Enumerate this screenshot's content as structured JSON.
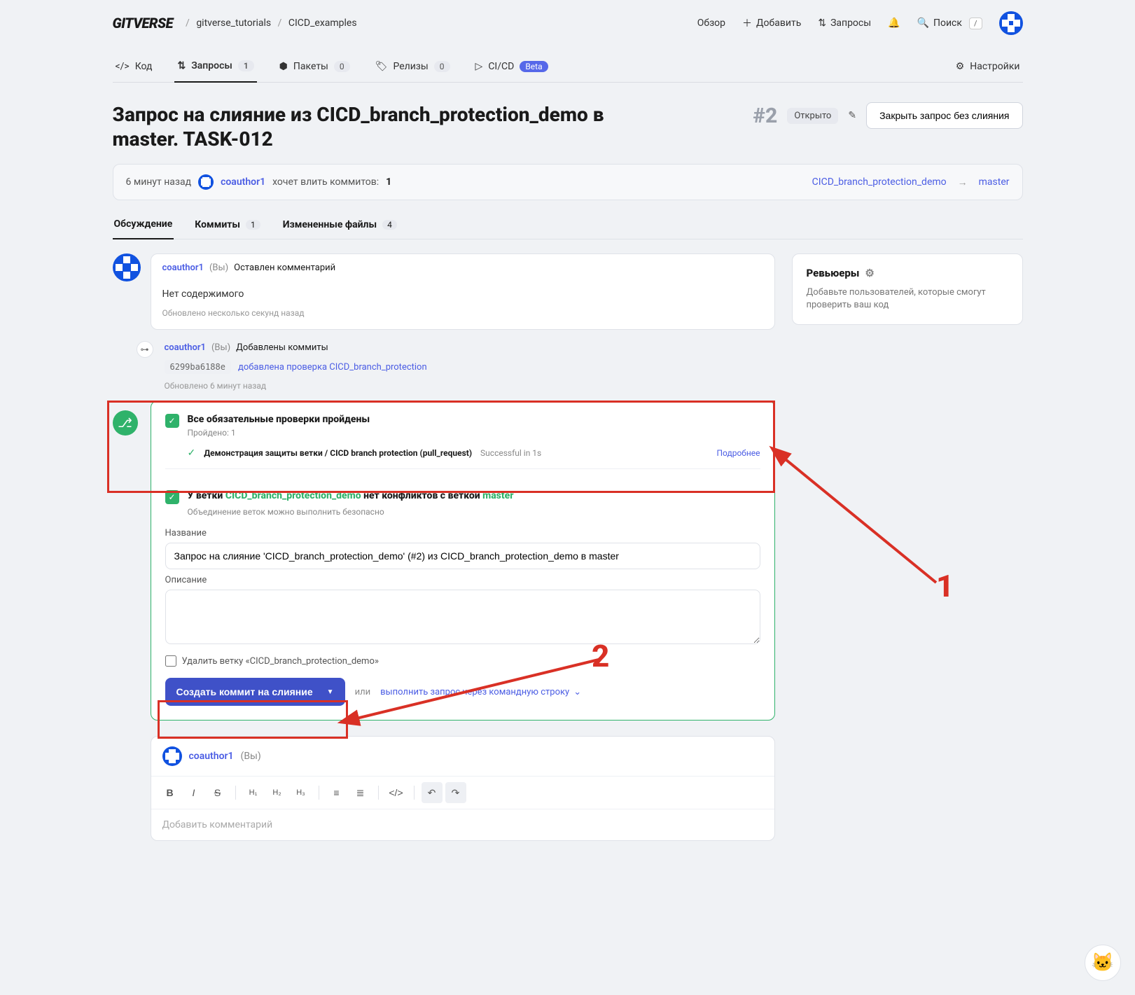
{
  "topbar": {
    "logo": "GITVERSE",
    "breadcrumb": {
      "org": "gitverse_tutorials",
      "repo": "CICD_examples"
    },
    "nav": {
      "overview": "Обзор",
      "add": "Добавить",
      "requests": "Запросы",
      "search": "Поиск",
      "search_shortcut": "/"
    }
  },
  "repotabs": {
    "code": {
      "label": "Код"
    },
    "requests": {
      "label": "Запросы",
      "count": "1"
    },
    "packages": {
      "label": "Пакеты",
      "count": "0"
    },
    "releases": {
      "label": "Релизы",
      "count": "0"
    },
    "cicd": {
      "label": "CI/CD",
      "badge": "Beta"
    },
    "settings": {
      "label": "Настройки"
    }
  },
  "pr": {
    "title": "Запрос на слияние из CICD_branch_protection_demo в master. TASK-012",
    "number": "#2",
    "status": "Открыто",
    "close_btn": "Закрыть запрос без слияния",
    "summary": {
      "time": "6 минут назад",
      "author": "coauthor1",
      "wants": "хочет влить коммитов:",
      "count": "1",
      "from_branch": "CICD_branch_protection_demo",
      "to_branch": "master"
    }
  },
  "subtabs": {
    "discussion": "Обсуждение",
    "commits": {
      "label": "Коммиты",
      "count": "1"
    },
    "files": {
      "label": "Измененные файлы",
      "count": "4"
    }
  },
  "sidebar": {
    "reviewers": {
      "title": "Ревьюеры",
      "desc": "Добавьте пользователей, которые смогут проверить ваш код"
    }
  },
  "comment1": {
    "author": "coauthor1",
    "you": "(Вы)",
    "action": "Оставлен комментарий",
    "body": "Нет содержимого",
    "updated": "Обновлено несколько секунд назад"
  },
  "commit_event": {
    "author": "coauthor1",
    "you": "(Вы)",
    "action": "Добавлены коммиты",
    "hash": "6299ba6188e",
    "msg": "добавлена проверка CICD_branch_protection",
    "updated": "Обновлено 6 минут назад"
  },
  "checks": {
    "all_passed": "Все обязательные проверки пройдены",
    "passed_sub": "Пройдено: 1",
    "check1": {
      "name": "Демонстрация защиты ветки / CICD branch protection (pull_request)",
      "status": "Successful in 1s",
      "details": "Подробнее"
    }
  },
  "conflicts": {
    "prefix": "У ветки",
    "branch1": "CICD_branch_protection_demo",
    "middle": "нет конфликтов с веткой",
    "branch2": "master",
    "sub": "Объединение веток можно выполнить безопасно"
  },
  "form": {
    "name_label": "Название",
    "name_value": "Запрос на слияние 'CICD_branch_protection_demo' (#2) из CICD_branch_protection_demo в master",
    "desc_label": "Описание",
    "delete_branch": "Удалить ветку «CICD_branch_protection_demo»",
    "merge_btn": "Создать коммит на слияние",
    "or": "или",
    "cli_link": "выполнить запрос через командную строку"
  },
  "editor": {
    "author": "coauthor1",
    "you": "(Вы)",
    "placeholder": "Добавить комментарий"
  },
  "annotations": {
    "n1": "1",
    "n2": "2"
  }
}
